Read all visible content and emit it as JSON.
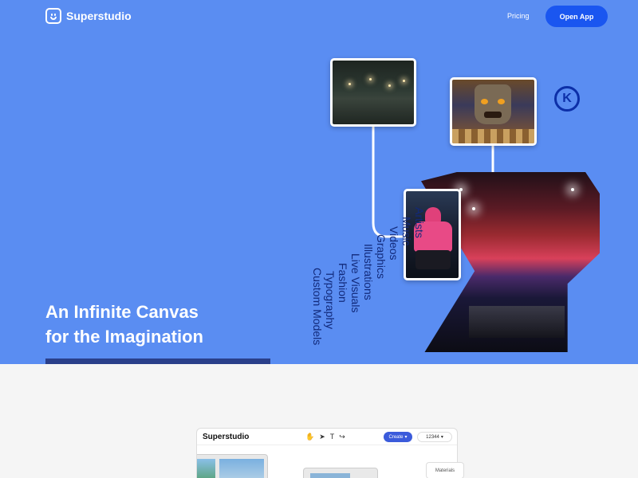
{
  "header": {
    "brand": "Superstudio",
    "nav": [
      {
        "label": "Pricing"
      }
    ],
    "cta_label": "Open App"
  },
  "hero": {
    "headline_line1": "An Infinite Canvas",
    "headline_line2": "for the Imagination",
    "categories": [
      "Artists",
      "Music",
      "Videos",
      "Graphics",
      "Illustrations",
      "Live Visuals",
      "Fashion",
      "Typography",
      "Custom Models"
    ],
    "badge_letter": "K"
  },
  "app_preview": {
    "brand": "Superstudio",
    "create_label": "Create",
    "counter_value": "12344",
    "materials_label": "Materials"
  },
  "colors": {
    "hero_bg": "#5a8df2",
    "cta_bg": "#1a56f0",
    "text_dark_blue": "#11297a"
  },
  "icons": [
    "logo-icon",
    "hand-tool-icon",
    "pointer-tool-icon",
    "text-tool-icon",
    "share-icon",
    "chevron-down-icon"
  ]
}
